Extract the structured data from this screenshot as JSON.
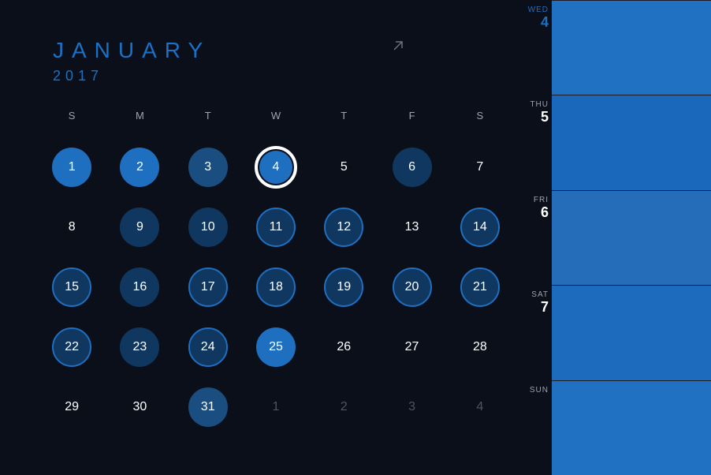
{
  "header": {
    "month": "JANUARY",
    "year": "2017"
  },
  "weekdays": [
    "S",
    "M",
    "T",
    "W",
    "T",
    "F",
    "S"
  ],
  "days": [
    {
      "n": "1",
      "style": "solid-bright"
    },
    {
      "n": "2",
      "style": "solid-bright"
    },
    {
      "n": "3",
      "style": "solid-medium"
    },
    {
      "n": "4",
      "style": "selected"
    },
    {
      "n": "5",
      "style": "plain"
    },
    {
      "n": "6",
      "style": "solid-dark"
    },
    {
      "n": "7",
      "style": "plain"
    },
    {
      "n": "8",
      "style": "plain"
    },
    {
      "n": "9",
      "style": "solid-dark"
    },
    {
      "n": "10",
      "style": "solid-dark"
    },
    {
      "n": "11",
      "style": "outline-bright"
    },
    {
      "n": "12",
      "style": "outline-bright"
    },
    {
      "n": "13",
      "style": "plain"
    },
    {
      "n": "14",
      "style": "outline-bright"
    },
    {
      "n": "15",
      "style": "outline-bright"
    },
    {
      "n": "16",
      "style": "solid-dark"
    },
    {
      "n": "17",
      "style": "outline-bright"
    },
    {
      "n": "18",
      "style": "outline-bright"
    },
    {
      "n": "19",
      "style": "outline-bright"
    },
    {
      "n": "20",
      "style": "outline-bright"
    },
    {
      "n": "21",
      "style": "outline-bright"
    },
    {
      "n": "22",
      "style": "outline-bright"
    },
    {
      "n": "23",
      "style": "solid-dark"
    },
    {
      "n": "24",
      "style": "outline-bright"
    },
    {
      "n": "25",
      "style": "solid-bright"
    },
    {
      "n": "26",
      "style": "plain"
    },
    {
      "n": "27",
      "style": "plain"
    },
    {
      "n": "28",
      "style": "plain"
    },
    {
      "n": "29",
      "style": "plain"
    },
    {
      "n": "30",
      "style": "plain"
    },
    {
      "n": "31",
      "style": "solid-medium"
    },
    {
      "n": "1",
      "style": "muted"
    },
    {
      "n": "2",
      "style": "muted"
    },
    {
      "n": "3",
      "style": "muted"
    },
    {
      "n": "4",
      "style": "muted"
    }
  ],
  "agenda": [
    {
      "dow": "WED",
      "date": "4",
      "highlight": true
    },
    {
      "dow": "THU",
      "date": "5",
      "highlight": false
    },
    {
      "dow": "FRI",
      "date": "6",
      "highlight": false
    },
    {
      "dow": "SAT",
      "date": "7",
      "highlight": false
    },
    {
      "dow": "SUN",
      "date": "",
      "highlight": false
    }
  ]
}
